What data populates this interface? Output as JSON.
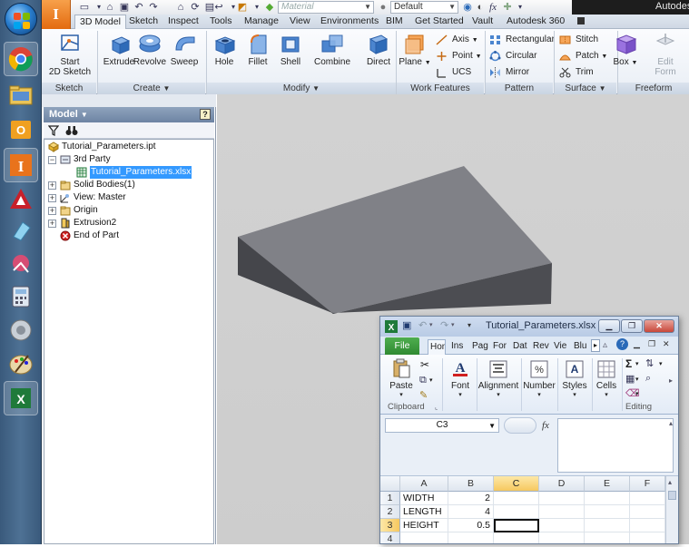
{
  "app": {
    "title": "Autodes"
  },
  "quick_access": {
    "material": "Material",
    "appearance": "Default",
    "fx": "fx"
  },
  "ribbon_tabs": [
    "3D Model",
    "Sketch",
    "Inspect",
    "Tools",
    "Manage",
    "View",
    "Environments",
    "BIM",
    "Get Started",
    "Vault",
    "Autodesk 360"
  ],
  "ribbon": {
    "groups": {
      "sketch": "Sketch",
      "create": "Create",
      "modify": "Modify",
      "work_features": "Work Features",
      "pattern": "Pattern",
      "surface": "Surface",
      "freeform": "Freeform"
    },
    "start_sketch": "Start\n2D Sketch",
    "extrude": "Extrude",
    "revolve": "Revolve",
    "sweep": "Sweep",
    "hole": "Hole",
    "fillet": "Fillet",
    "shell": "Shell",
    "combine": "Combine",
    "direct": "Direct",
    "plane": "Plane",
    "axis": "Axis",
    "point": "Point",
    "ucs": "UCS",
    "rectangular": "Rectangular",
    "circular": "Circular",
    "mirror": "Mirror",
    "stitch": "Stitch",
    "patch": "Patch",
    "trim": "Trim",
    "box": "Box",
    "edit_form": "Edit\nForm"
  },
  "browser": {
    "title": "Model",
    "help": "?",
    "tree": [
      {
        "label": "Tutorial_Parameters.ipt"
      },
      {
        "label": "3rd Party"
      },
      {
        "label": "Tutorial_Parameters.xlsx"
      },
      {
        "label": "Solid Bodies(1)"
      },
      {
        "label": "View: Master"
      },
      {
        "label": "Origin"
      },
      {
        "label": "Extrusion2"
      },
      {
        "label": "End of Part"
      }
    ]
  },
  "excel": {
    "title": "Tutorial_Parameters.xlsx - M",
    "tabs": {
      "file": "File",
      "home": "Hon",
      "insert": "Ins",
      "page": "Pag",
      "formulas": "For",
      "data": "Dat",
      "review": "Rev",
      "view": "Vie",
      "blue": "Blu"
    },
    "ribbon": {
      "paste": "Paste",
      "font": "Font",
      "alignment": "Alignment",
      "number": "Number",
      "styles": "Styles",
      "cells": "Cells",
      "clipboard": "Clipboard",
      "editing": "Editing",
      "percent_symbol": "%",
      "sigma_symbol": "Σ"
    },
    "name_box": "C3",
    "fx_label": "fx",
    "columns": [
      "A",
      "B",
      "C",
      "D",
      "E",
      "F"
    ],
    "rows": [
      {
        "num": "1",
        "a": "WIDTH",
        "b": "2"
      },
      {
        "num": "2",
        "a": "LENGTH",
        "b": "4"
      },
      {
        "num": "3",
        "a": "HEIGHT",
        "b": "0.5"
      },
      {
        "num": "4",
        "a": "",
        "b": ""
      }
    ],
    "active_cell": "C3"
  }
}
